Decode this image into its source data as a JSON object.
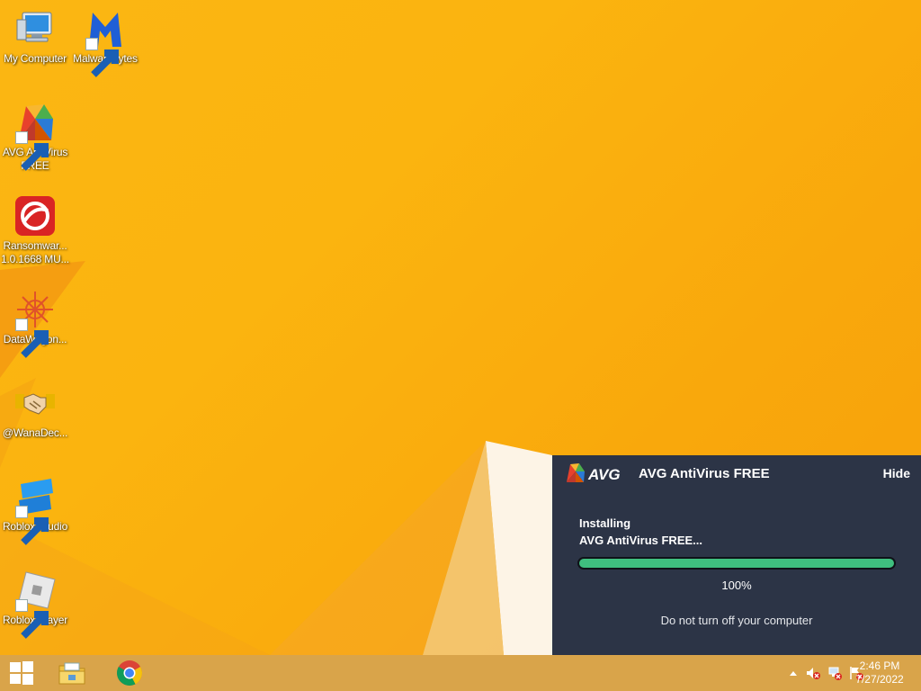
{
  "desktop": {
    "icons": [
      {
        "label": "My Computer",
        "icon": "computer-icon"
      },
      {
        "label": "Malwarebytes",
        "icon": "malwarebytes-icon"
      },
      {
        "label": "AVG AntiVirus\nFREE",
        "icon": "avg-icon"
      },
      {
        "label": "Ransomwar...\n1.0.1668 MU...",
        "icon": "ransomware-tool-icon"
      },
      {
        "label": "DataWagon...",
        "icon": "datawagon-icon"
      },
      {
        "label": "@WanaDec...",
        "icon": "handshake-icon"
      },
      {
        "label": "Roblox Studio",
        "icon": "roblox-studio-icon"
      },
      {
        "label": "Roblox Player",
        "icon": "roblox-player-icon"
      }
    ]
  },
  "avg_panel": {
    "logo_text": "AVG",
    "title": "AVG AntiVirus FREE",
    "hide_label": "Hide",
    "status_line_1": "Installing",
    "status_line_2": "AVG AntiVirus FREE...",
    "progress_fraction": 1.0,
    "progress_text": "100%",
    "warning": "Do not turn off your computer",
    "colors": {
      "background": "#2c3446",
      "progress": "#3fbf7f"
    }
  },
  "taskbar": {
    "start_icon": "windows-logo-icon",
    "pinned": [
      {
        "name": "file-explorer-icon"
      },
      {
        "name": "chrome-icon"
      }
    ],
    "tray": {
      "icons": [
        "show-hidden-icons-chevron",
        "volume-muted-icon",
        "network-error-icon",
        "action-center-flag-icon"
      ],
      "time": "2:46 PM",
      "date": "7/27/2022"
    }
  },
  "colors": {
    "wallpaper": "#fbb613",
    "taskbar": "#d9a44a"
  }
}
